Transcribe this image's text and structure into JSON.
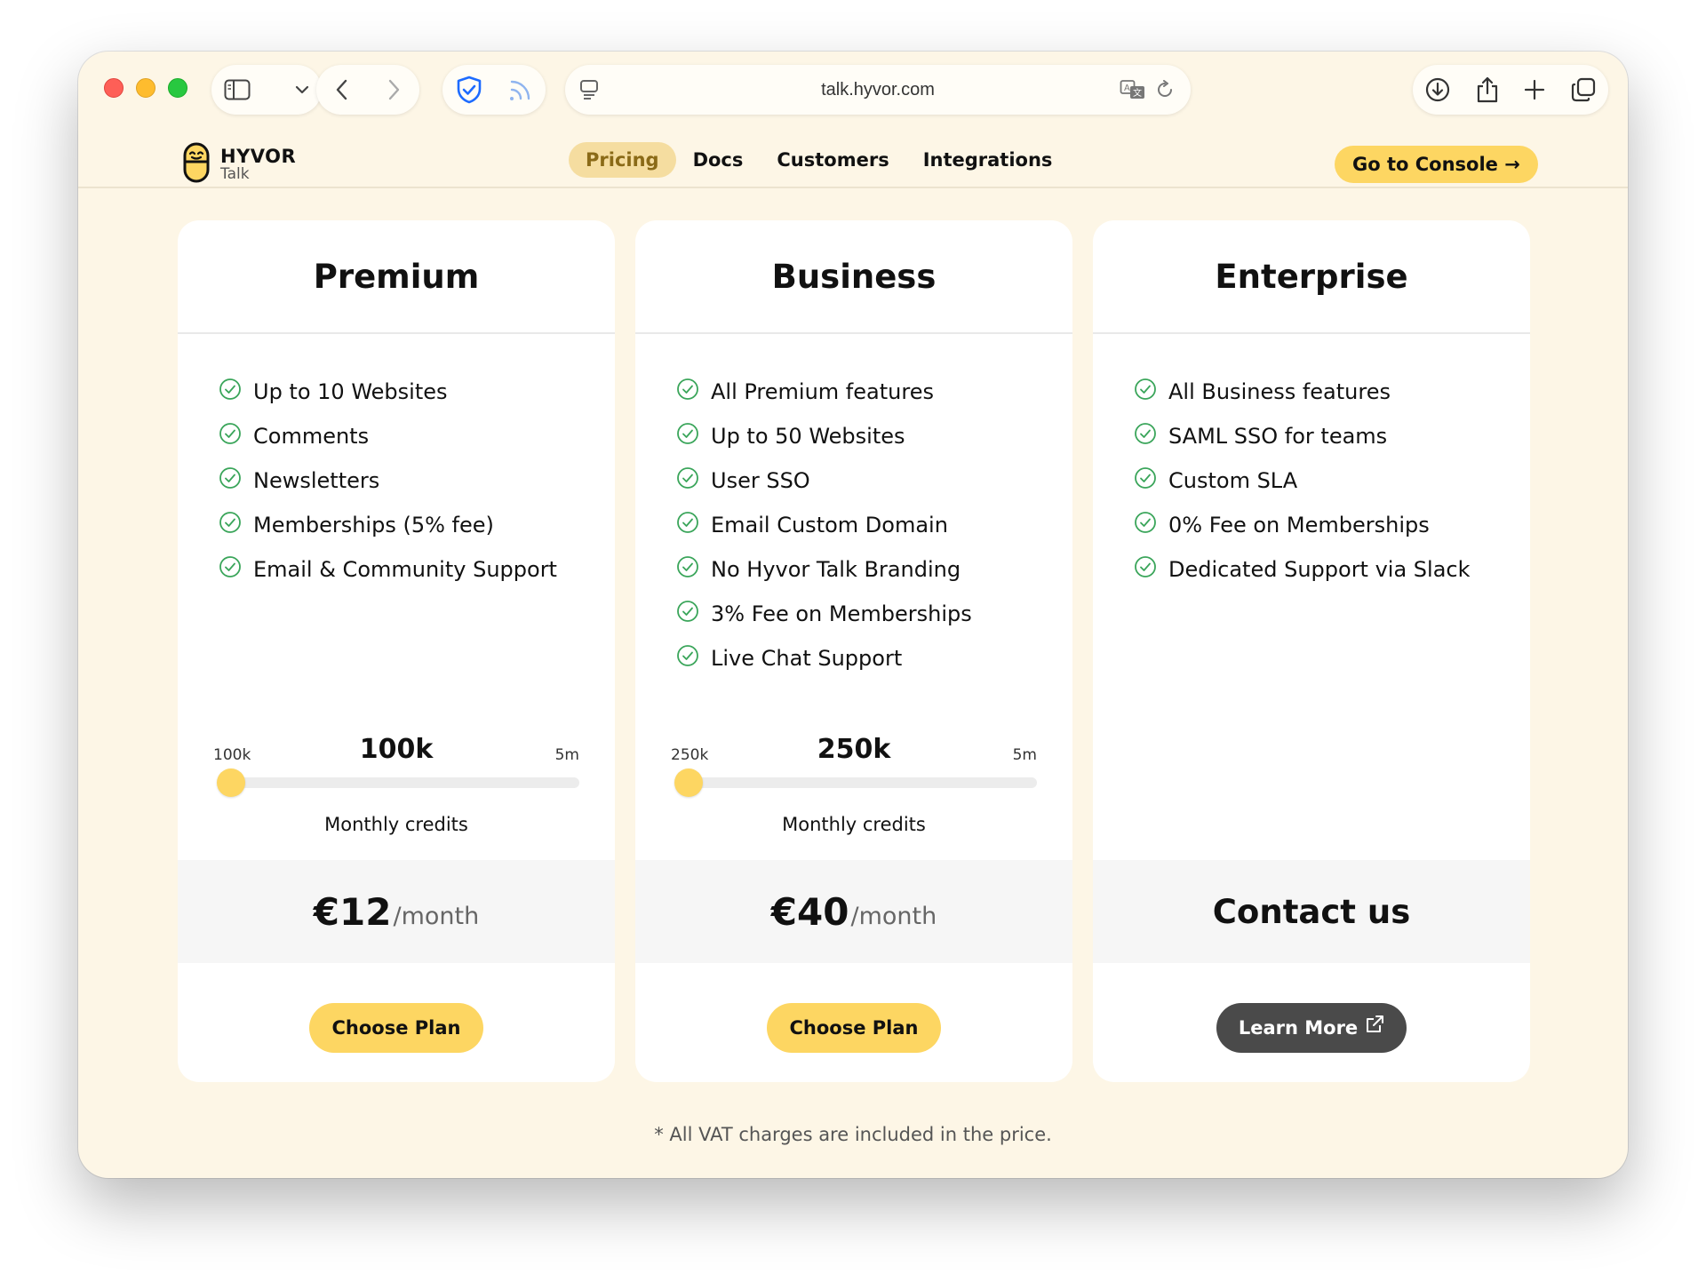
{
  "browser": {
    "url": "talk.hyvor.com"
  },
  "brand": {
    "name": "HYVOR",
    "product": "Talk"
  },
  "nav": {
    "links": [
      "Pricing",
      "Docs",
      "Customers",
      "Integrations"
    ],
    "active": "Pricing",
    "console_button": "Go to Console →"
  },
  "plans": [
    {
      "title": "Premium",
      "features": [
        "Up to 10 Websites",
        "Comments",
        "Newsletters",
        "Memberships (5% fee)",
        "Email & Community Support"
      ],
      "credits": {
        "min_label": "100k",
        "max_label": "5m",
        "current": "100k",
        "position_fraction": 0.0,
        "caption": "Monthly credits"
      },
      "price": "€12",
      "period": "/month",
      "button": "Choose Plan"
    },
    {
      "title": "Business",
      "features": [
        "All Premium features",
        "Up to 50 Websites",
        "User SSO",
        "Email Custom Domain",
        "No Hyvor Talk Branding",
        "3% Fee on Memberships",
        "Live Chat Support"
      ],
      "credits": {
        "min_label": "250k",
        "max_label": "5m",
        "current": "250k",
        "position_fraction": 0.0,
        "caption": "Monthly credits"
      },
      "price": "€40",
      "period": "/month",
      "button": "Choose Plan"
    },
    {
      "title": "Enterprise",
      "features": [
        "All Business features",
        "SAML SSO for teams",
        "Custom SLA",
        "0% Fee on Memberships",
        "Dedicated Support via Slack"
      ],
      "contact": "Contact us",
      "button": "Learn More"
    }
  ],
  "footnote": "* All VAT charges are included in the price.",
  "colors": {
    "accent": "#fdd662",
    "page_bg": "#fdf6e6",
    "check": "#3aa55a",
    "dark_button": "#4a4a4a"
  }
}
